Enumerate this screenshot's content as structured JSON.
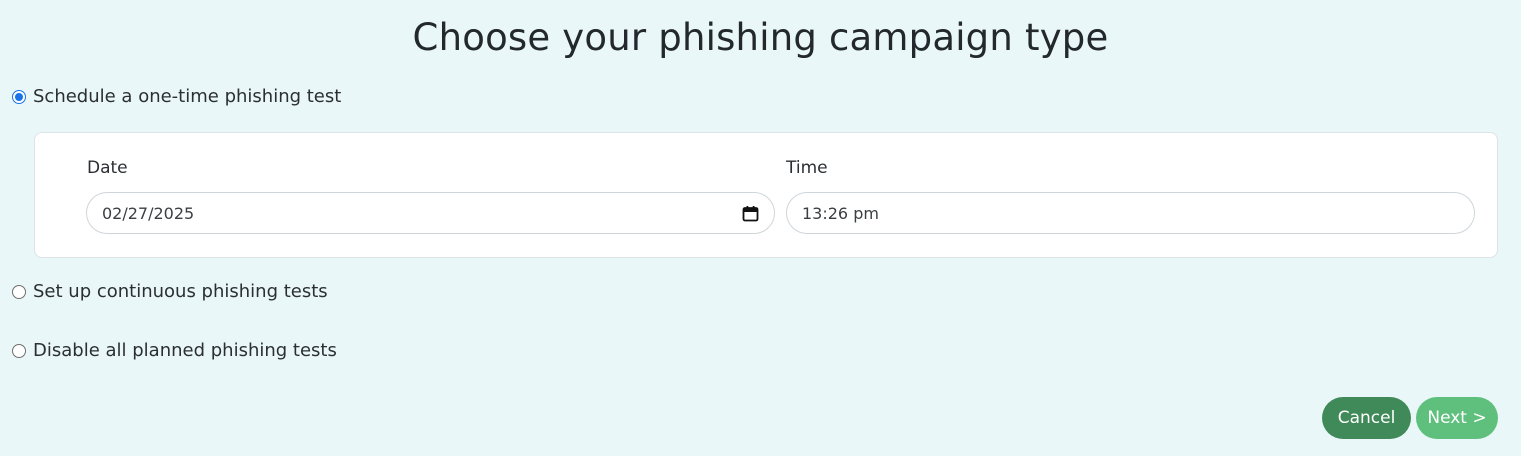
{
  "page": {
    "title": "Choose your phishing campaign type"
  },
  "options": {
    "one_time": {
      "label": "Schedule a one-time phishing test",
      "selected": true
    },
    "continuous": {
      "label": "Set up continuous phishing tests",
      "selected": false
    },
    "disable": {
      "label": "Disable all planned phishing tests",
      "selected": false
    }
  },
  "schedule": {
    "date_label": "Date",
    "date_value": "02/27/2025",
    "time_label": "Time",
    "time_value": "13:26 pm"
  },
  "actions": {
    "cancel_label": "Cancel",
    "next_label": "Next >"
  },
  "colors": {
    "background": "#e9f7f8",
    "radio_selected": "#1a73e8",
    "cancel_button": "#3f8a58",
    "next_button": "#5fc07e"
  },
  "icons": {
    "date_picker": "calendar-icon"
  }
}
